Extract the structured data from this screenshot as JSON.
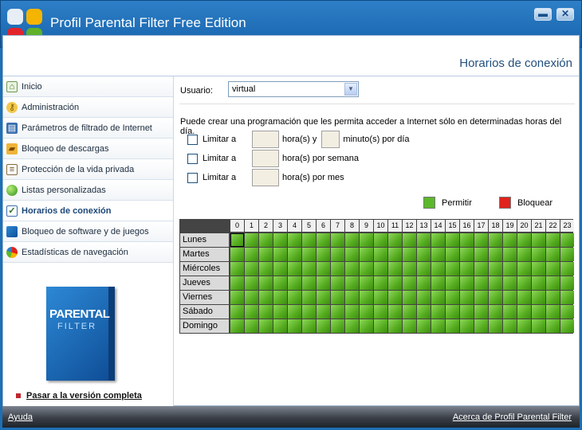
{
  "window": {
    "title": "Profil Parental Filter Free Edition",
    "minimize_glyph": "▬",
    "close_glyph": "✕"
  },
  "section": {
    "title": "Horarios de conexión"
  },
  "sidebar": {
    "items": [
      {
        "label": "Inicio",
        "icon": "home-icon"
      },
      {
        "label": "Administración",
        "icon": "keys-icon"
      },
      {
        "label": "Parámetros de filtrado de Internet",
        "icon": "filter-icon"
      },
      {
        "label": "Bloqueo de descargas",
        "icon": "folder-icon"
      },
      {
        "label": "Protección de la vida privada",
        "icon": "document-icon"
      },
      {
        "label": "Listas personalizadas",
        "icon": "globe-icon"
      },
      {
        "label": "Horarios de conexión",
        "icon": "checklist-icon",
        "active": true
      },
      {
        "label": "Bloqueo de software y de juegos",
        "icon": "software-box-icon"
      },
      {
        "label": "Estadísticas de navegación",
        "icon": "pie-chart-icon"
      }
    ]
  },
  "product_box": {
    "title": "PARENTAL",
    "subtitle": "FILTER"
  },
  "promo": {
    "link_label": "Pasar a la versión completa"
  },
  "form": {
    "user_label": "Usuario:",
    "user_value": "virtual",
    "description": "Puede crear una programación que les permita acceder a Internet sólo en determinadas horas del día.",
    "limit_label": "Limitar a",
    "per_day_hours_suffix": "hora(s) y",
    "per_day_minutes_suffix": "minuto(s) por día",
    "per_week_suffix": "hora(s) por semana",
    "per_month_suffix": "hora(s) por mes"
  },
  "legend": {
    "allow_label": "Permitir",
    "allow_color": "#5cb82b",
    "block_label": "Bloquear",
    "block_color": "#e0231c"
  },
  "schedule": {
    "hours": [
      "0",
      "1",
      "2",
      "3",
      "4",
      "5",
      "6",
      "7",
      "8",
      "9",
      "10",
      "11",
      "12",
      "13",
      "14",
      "15",
      "16",
      "17",
      "18",
      "19",
      "20",
      "21",
      "22",
      "23"
    ],
    "days": [
      "Lunes",
      "Martes",
      "Miércoles",
      "Jueves",
      "Viernes",
      "Sábado",
      "Domingo"
    ],
    "state": "all-permitted"
  },
  "statusbar": {
    "help_label": "Ayuda",
    "about_label": "Acerca de Profil Parental Filter"
  }
}
